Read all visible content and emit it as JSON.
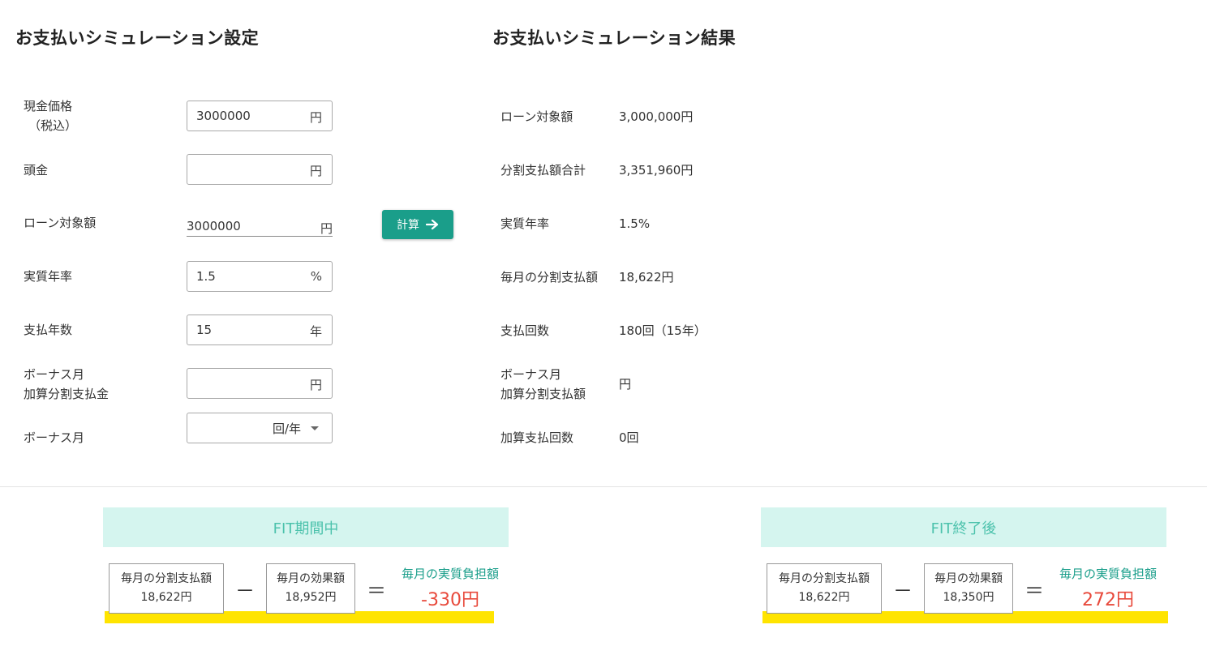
{
  "settings": {
    "title": "お支払いシミュレーション設定",
    "cash_price": {
      "label_line1": "現金価格",
      "label_line2": "（税込）",
      "value": "3000000",
      "unit": "円"
    },
    "down_payment": {
      "label": "頭金",
      "value": "",
      "unit": "円"
    },
    "loan_amount": {
      "label": "ローン対象額",
      "value": "3000000",
      "unit": "円"
    },
    "annual_rate": {
      "label": "実質年率",
      "value": "1.5",
      "unit": "%"
    },
    "years": {
      "label": "支払年数",
      "value": "15",
      "unit": "年"
    },
    "bonus_amount": {
      "label_line1": "ボーナス月",
      "label_line2": "加算分割支払金",
      "value": "",
      "unit": "円"
    },
    "bonus_month": {
      "label": "ボーナス月",
      "selected": "回/年"
    },
    "calc_button": "計算"
  },
  "results": {
    "title": "お支払いシミュレーション結果",
    "rows": [
      {
        "label": "ローン対象額",
        "value": "3,000,000円"
      },
      {
        "label": "分割支払額合計",
        "value": "3,351,960円"
      },
      {
        "label": "実質年率",
        "value": "1.5%"
      },
      {
        "label": "毎月の分割支払額",
        "value": "18,622円"
      },
      {
        "label": "支払回数",
        "value": "180回（15年）"
      },
      {
        "label_line1": "ボーナス月",
        "label_line2": "加算分割支払額",
        "value": "円"
      },
      {
        "label": "加算支払回数",
        "value": "0回"
      }
    ]
  },
  "fit_during": {
    "heading": "FIT期間中",
    "payment_label": "毎月の分割支払額",
    "payment_value": "18,622円",
    "minus": "－",
    "effect_label": "毎月の効果額",
    "effect_value": "18,952円",
    "equals": "＝",
    "burden_label": "毎月の実質負担額",
    "burden_value": "-330円"
  },
  "fit_after": {
    "heading": "FIT終了後",
    "payment_label": "毎月の分割支払額",
    "payment_value": "18,622円",
    "minus": "－",
    "effect_label": "毎月の効果額",
    "effect_value": "18,350円",
    "equals": "＝",
    "burden_label": "毎月の実質負担額",
    "burden_value": "272円"
  },
  "colors": {
    "accent": "#1a9e8a",
    "panel_bg": "#d5f5ef",
    "panel_text": "#4cc2ac",
    "highlight": "#ffe400",
    "negative": "#e84a3c"
  }
}
